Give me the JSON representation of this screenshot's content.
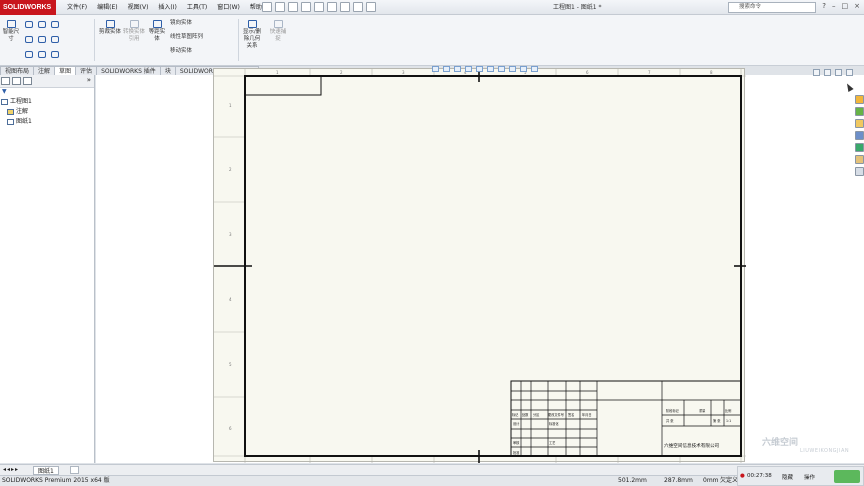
{
  "app": {
    "logo": "SOLIDWORKS",
    "title": "工程图1 - 图纸1 *"
  },
  "menu": [
    "文件(F)",
    "编辑(E)",
    "视图(V)",
    "插入(I)",
    "工具(T)",
    "窗口(W)",
    "帮助(H)"
  ],
  "search": {
    "placeholder": "搜索命令"
  },
  "ribbon": {
    "smart_dim": "智能尺寸",
    "convert": "转换实体引用",
    "offset": "等距实体",
    "mirror": "镜向实体",
    "linear_pattern": "线性草图阵列",
    "move": "移动实体",
    "show_delete": "显示/删除几何关系",
    "quick_snap": "快速捕捉",
    "trim": "剪裁实体"
  },
  "tabs": [
    "视图布局",
    "注解",
    "草图",
    "评估",
    "SOLIDWORKS 插件",
    "块",
    "SOLIDWORKS Inspection"
  ],
  "active_tab_index": 2,
  "feature_tree": {
    "root": "工程图1",
    "items": [
      "注解",
      "图纸1"
    ]
  },
  "drawing": {
    "zone_rows": [
      "1",
      "2",
      "3",
      "4",
      "5",
      "6"
    ],
    "zone_cols": [
      "1",
      "2",
      "3",
      "4",
      "5",
      "6",
      "7",
      "8"
    ],
    "company": "六维空间信息技术有限公司",
    "tb_labels": [
      "标记",
      "处数",
      "分区",
      "更改文件号",
      "签名",
      "年月日",
      "设计",
      "标准化",
      "阶段标记",
      "重量",
      "比例",
      "审核",
      "工艺",
      "批准",
      "共 张",
      "第 张"
    ],
    "tb_ratio": "1:1"
  },
  "sheet_tab": "图纸1",
  "status": {
    "product": "SOLIDWORKS Premium 2015 x64 版",
    "x": "501.2mm",
    "y": "287.8mm",
    "z": "0mm",
    "state": "欠定义"
  },
  "recorder": {
    "time": "00:27:38",
    "label1": "隐藏",
    "label2": "操作"
  },
  "watermark": {
    "text": "六维空间",
    "sub": "LIUWEIKONGJIAN"
  },
  "colors": {
    "logo_red": "#c8161d",
    "sheet_bg": "#f8f8f0",
    "ribbon_blue": "#2f5fa8"
  }
}
